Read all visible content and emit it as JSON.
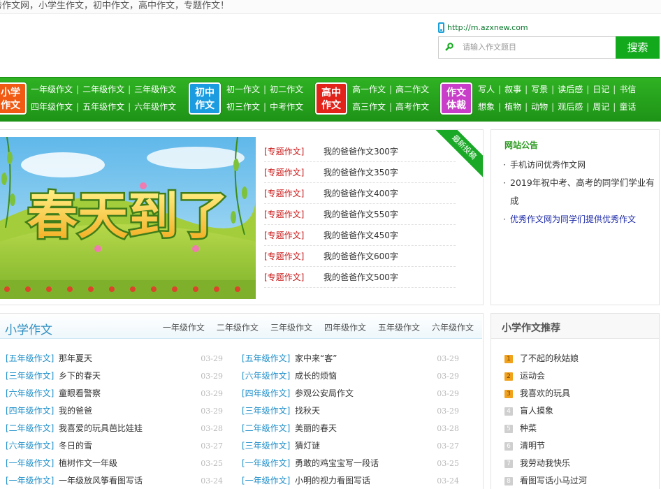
{
  "topbar": {
    "slogan": "秀作文网，小学生作文，初中作文，高中作文，专题作文！"
  },
  "header": {
    "mobile_url": "http://m.azxnew.com",
    "search_placeholder": "请输入作文题目",
    "search_label": "搜索"
  },
  "nav": {
    "groups": [
      {
        "badge_line1": "小学",
        "badge_line2": "作文",
        "badge_color": "#f05a13",
        "row1": [
          "一年级作文",
          "二年级作文",
          "三年级作文"
        ],
        "row2": [
          "四年级作文",
          "五年级作文",
          "六年级作文"
        ]
      },
      {
        "badge_line1": "初中",
        "badge_line2": "作文",
        "badge_color": "#1b9be0",
        "row1": [
          "初一作文",
          "初二作文"
        ],
        "row2": [
          "初三作文",
          "中考作文"
        ]
      },
      {
        "badge_line1": "高中",
        "badge_line2": "作文",
        "badge_color": "#e2231a",
        "row1": [
          "高一作文",
          "高二作文"
        ],
        "row2": [
          "高三作文",
          "高考作文"
        ]
      },
      {
        "badge_line1": "作文",
        "badge_line2": "体裁",
        "badge_color": "#c93ec9",
        "row1": [
          "写人",
          "叙事",
          "写景",
          "读后感",
          "日记",
          "书信"
        ],
        "row2": [
          "想象",
          "植物",
          "动物",
          "观后感",
          "周记",
          "童话"
        ]
      }
    ]
  },
  "feature": {
    "banner_text": "春天到了",
    "ribbon": "最新投稿",
    "topics": [
      {
        "tag": "[专题作文]",
        "title": "我的爸爸作文300字"
      },
      {
        "tag": "[专题作文]",
        "title": "我的爸爸作文350字"
      },
      {
        "tag": "[专题作文]",
        "title": "我的爸爸作文400字"
      },
      {
        "tag": "[专题作文]",
        "title": "我的爸爸作文550字"
      },
      {
        "tag": "[专题作文]",
        "title": "我的爸爸作文450字"
      },
      {
        "tag": "[专题作文]",
        "title": "我的爸爸作文600字"
      },
      {
        "tag": "[专题作文]",
        "title": "我的爸爸作文500字"
      }
    ]
  },
  "notice": {
    "title": "网站公告",
    "items": [
      "手机访问优秀作文网",
      "2019年祝中考、高考的同学们学业有成",
      "优秀作文网为同学们提供优秀作文"
    ]
  },
  "primary": {
    "title": "小学作文",
    "tabs": [
      "一年级作文",
      "二年级作文",
      "三年级作文",
      "四年级作文",
      "五年级作文",
      "六年级作文"
    ],
    "left": [
      {
        "tag": "[五年级作文]",
        "title": "那年夏天",
        "date": "03-29"
      },
      {
        "tag": "[三年级作文]",
        "title": "乡下的春天",
        "date": "03-29"
      },
      {
        "tag": "[六年级作文]",
        "title": "童眼看警察",
        "date": "03-29"
      },
      {
        "tag": "[四年级作文]",
        "title": "我的爸爸",
        "date": "03-29"
      },
      {
        "tag": "[二年级作文]",
        "title": "我喜爱的玩具芭比娃娃",
        "date": "03-28"
      },
      {
        "tag": "[六年级作文]",
        "title": "冬日的雪",
        "date": "03-27"
      },
      {
        "tag": "[一年级作文]",
        "title": "植树作文一年级",
        "date": "03-25"
      },
      {
        "tag": "[一年级作文]",
        "title": "一年级放风筝看图写话",
        "date": "03-24"
      }
    ],
    "right": [
      {
        "tag": "[五年级作文]",
        "title": "家中来“客”",
        "date": "03-29"
      },
      {
        "tag": "[六年级作文]",
        "title": "成长的烦恼",
        "date": "03-29"
      },
      {
        "tag": "[四年级作文]",
        "title": "参观公安局作文",
        "date": "03-29"
      },
      {
        "tag": "[三年级作文]",
        "title": "找秋天",
        "date": "03-29"
      },
      {
        "tag": "[二年级作文]",
        "title": "美丽的春天",
        "date": "03-28"
      },
      {
        "tag": "[三年级作文]",
        "title": "猜灯谜",
        "date": "03-27"
      },
      {
        "tag": "[一年级作文]",
        "title": "勇敢的鸡宝宝写一段话",
        "date": "03-25"
      },
      {
        "tag": "[一年级作文]",
        "title": "小明的视力看图写话",
        "date": "03-24"
      }
    ]
  },
  "recommend": {
    "title": "小学作文推荐",
    "items": [
      {
        "num": "1",
        "title": "了不起的秋姑娘"
      },
      {
        "num": "2",
        "title": "运动会"
      },
      {
        "num": "3",
        "title": "我喜欢的玩具"
      },
      {
        "num": "4",
        "title": "盲人摸象"
      },
      {
        "num": "5",
        "title": "种菜"
      },
      {
        "num": "6",
        "title": "清明节"
      },
      {
        "num": "7",
        "title": "我劳动我快乐"
      },
      {
        "num": "8",
        "title": "看图写话小马过河"
      }
    ]
  }
}
